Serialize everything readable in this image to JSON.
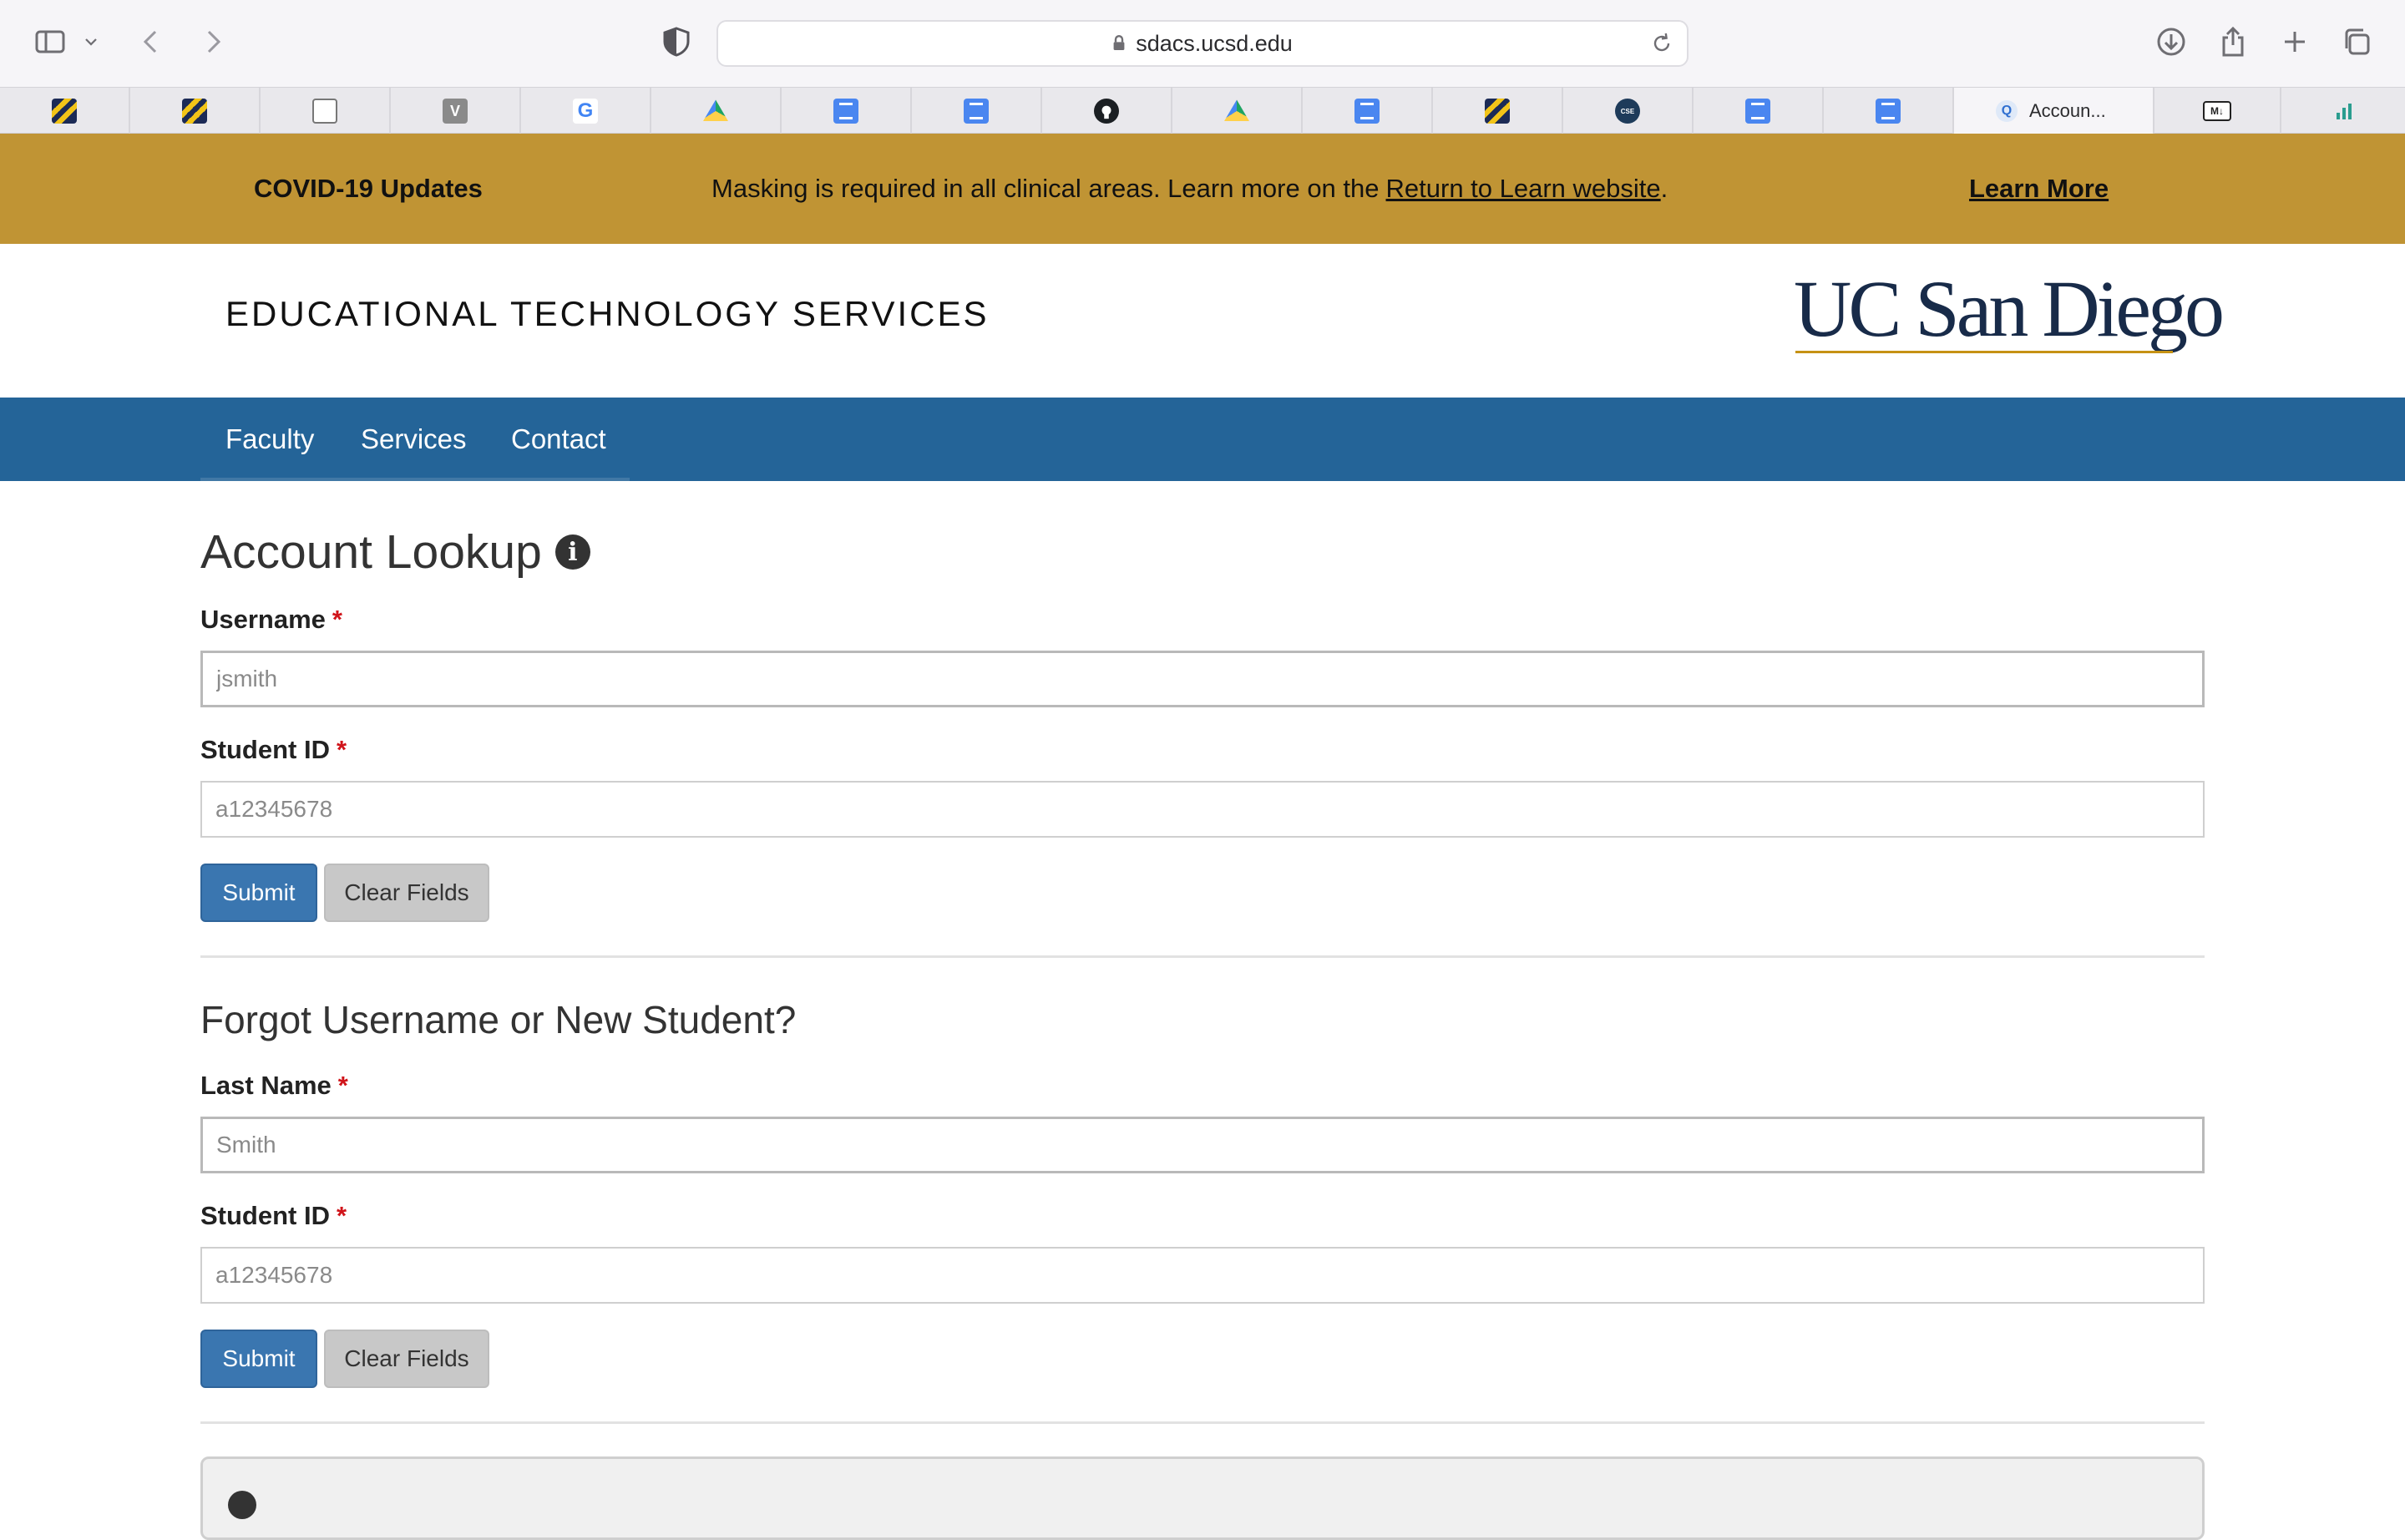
{
  "browser": {
    "url": "sdacs.ucsd.edu",
    "tabs": [
      {
        "icon": "stripe-favicon",
        "glyph": ""
      },
      {
        "icon": "stripe-favicon",
        "glyph": ""
      },
      {
        "icon": "notes-favicon",
        "glyph": ""
      },
      {
        "icon": "v-favicon",
        "glyph": "V"
      },
      {
        "icon": "google-favicon",
        "glyph": "G"
      },
      {
        "icon": "drive-favicon",
        "glyph": ""
      },
      {
        "icon": "docs-favicon",
        "glyph": ""
      },
      {
        "icon": "docs-favicon",
        "glyph": ""
      },
      {
        "icon": "github-favicon",
        "glyph": ""
      },
      {
        "icon": "drive-favicon",
        "glyph": ""
      },
      {
        "icon": "docs-favicon",
        "glyph": ""
      },
      {
        "icon": "stripe-favicon",
        "glyph": ""
      },
      {
        "icon": "cse-favicon",
        "glyph": "CSE"
      },
      {
        "icon": "docs-favicon",
        "glyph": ""
      },
      {
        "icon": "docs-favicon",
        "glyph": ""
      },
      {
        "icon": "account-favicon",
        "glyph": "Q",
        "title": "Accoun...",
        "active": true
      },
      {
        "icon": "markdown-favicon",
        "glyph": "M↓"
      },
      {
        "icon": "bars-favicon",
        "glyph": "▮▮▮"
      }
    ]
  },
  "banner": {
    "title": "COVID-19 Updates",
    "message": "Masking is required in all clinical areas. Learn more on the",
    "link": "Return to Learn website",
    "period": ".",
    "learn_more": "Learn More",
    "color": "#c09434"
  },
  "header": {
    "site_title": "EDUCATIONAL TECHNOLOGY SERVICES",
    "logo_text": "UC San Diego"
  },
  "nav": {
    "items": [
      "Faculty",
      "Services",
      "Contact"
    ],
    "color": "#246498"
  },
  "lookup": {
    "title": "Account Lookup",
    "username_label": "Username",
    "username_placeholder": "jsmith",
    "student_id_label": "Student ID",
    "student_id_placeholder": "a12345678",
    "submit": "Submit",
    "clear": "Clear Fields"
  },
  "forgot": {
    "title": "Forgot Username or New Student?",
    "last_name_label": "Last Name",
    "last_name_placeholder": "Smith",
    "student_id_label": "Student ID",
    "student_id_placeholder": "a12345678",
    "submit": "Submit",
    "clear": "Clear Fields"
  },
  "required_mark": "*"
}
